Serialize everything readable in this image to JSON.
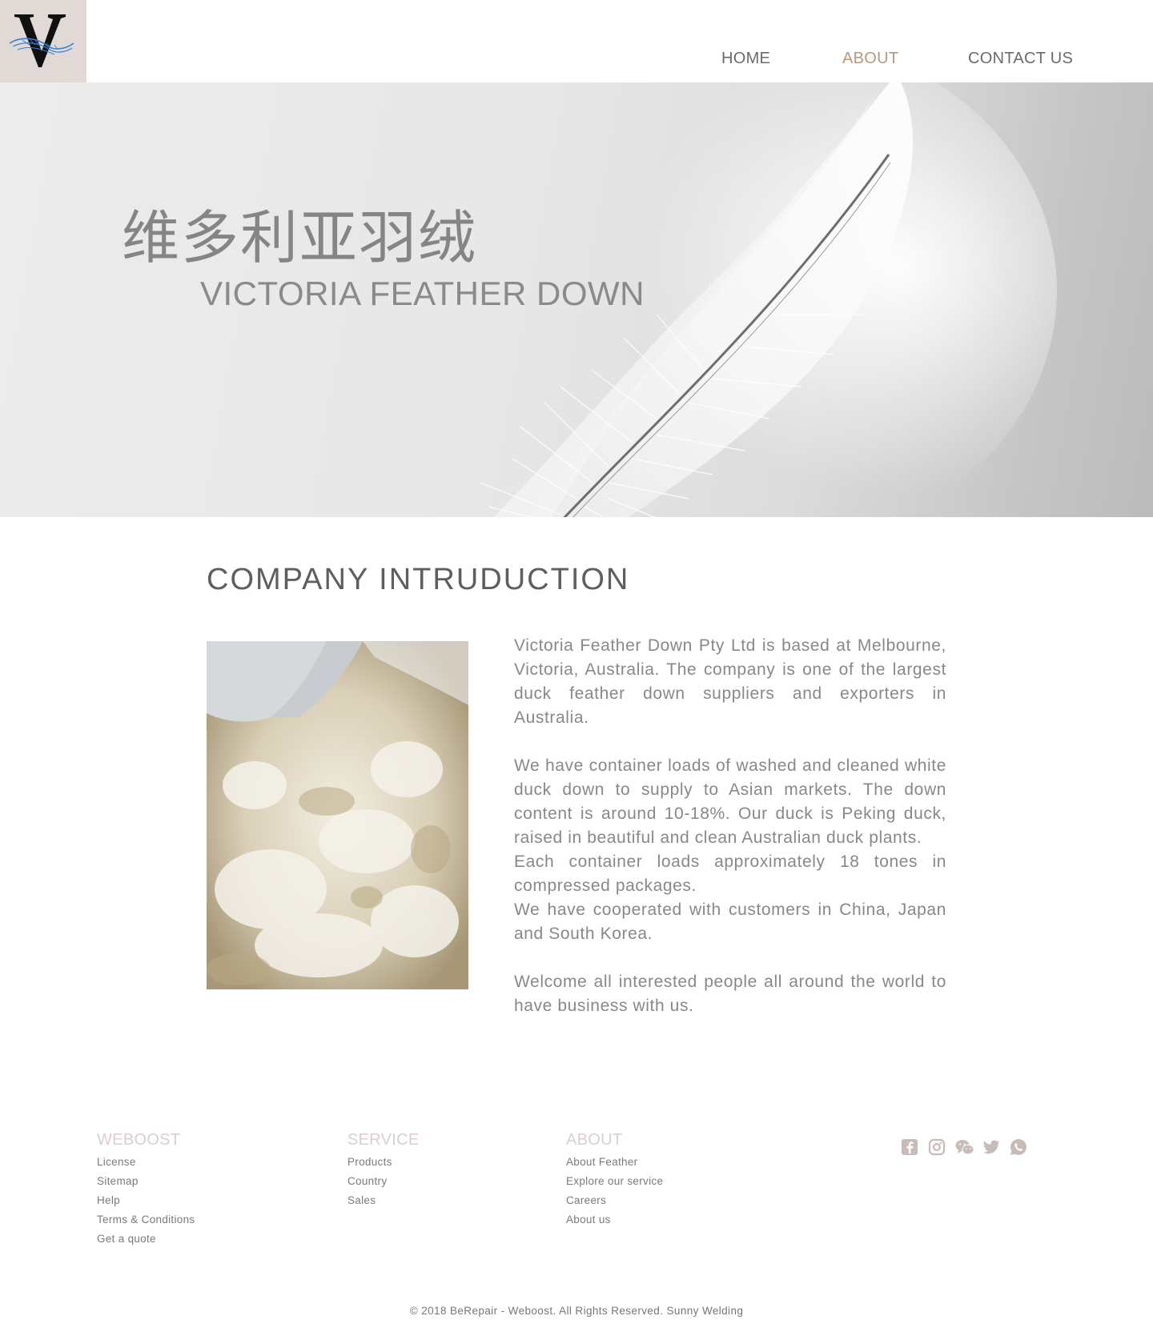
{
  "logo": {
    "letter": "V"
  },
  "nav": {
    "items": [
      {
        "label": "HOME"
      },
      {
        "label": "ABOUT"
      },
      {
        "label": "CONTACT US"
      }
    ],
    "active_color": "#b8977d"
  },
  "hero": {
    "title_cn": "维多利亚羽绒",
    "title_en": "VICTORIA FEATHER DOWN"
  },
  "intro": {
    "title": "COMPANY  INTRUDUCTION",
    "paragraphs": "Victoria Feather Down Pty Ltd is based at Melbourne, Victoria, Australia. The company is one of the largest duck feather down suppliers and exporters in Australia.\n\nWe have container loads of washed and cleaned white duck down to supply to Asian markets. The down content is around 10-18%.  Our duck is Peking duck, raised in beautiful and clean Australian duck plants.\nEach container loads approximately 18 tones in compressed packages.\nWe have cooperated with customers in China, Japan and South Korea.\n\nWelcome all interested people all around the world to have business with us."
  },
  "footer": {
    "weboost": {
      "heading": "WEBOOST",
      "links": [
        "License",
        "Sitemap",
        "Help",
        "Terms  &  Conditions",
        "Get  a  quote"
      ]
    },
    "service": {
      "heading": "SERVICE",
      "links": [
        "Products",
        "Country",
        "Sales"
      ]
    },
    "about": {
      "heading": "ABOUT",
      "links": [
        "About  Feather",
        "Explore  our  service",
        "Careers",
        "About  us"
      ]
    },
    "social_icons": [
      "facebook-icon",
      "instagram-icon",
      "wechat-icon",
      "twitter-icon",
      "whatsapp-icon"
    ],
    "icon_color": "#c8bcb8",
    "copyright": "© 2018 BeRepair - Weboost. All Rights Reserved. Sunny Welding"
  }
}
